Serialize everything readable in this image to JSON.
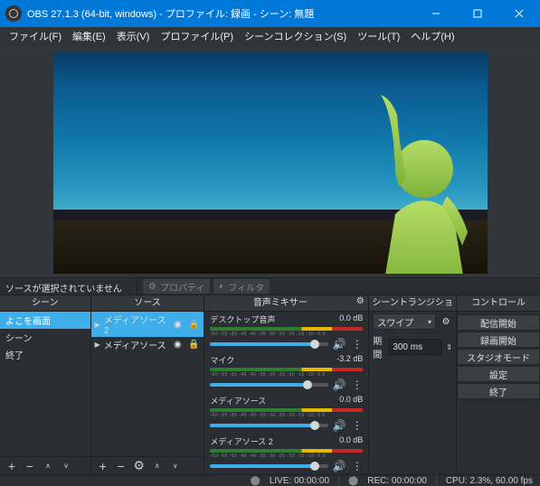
{
  "title": "OBS 27.1.3 (64-bit, windows) - プロファイル: 録画 - シーン: 無題",
  "menu": [
    "ファイル(F)",
    "編集(E)",
    "表示(V)",
    "プロファイル(P)",
    "シーンコレクション(S)",
    "ツール(T)",
    "ヘルプ(H)"
  ],
  "sources_status": "ソースが選択されていません",
  "toolbar": {
    "properties": "プロパティ",
    "filters": "フィルタ"
  },
  "docks": {
    "scenes": "シーン",
    "sources": "ソース",
    "mixer": "音声ミキサー",
    "transitions": "シーントランジション",
    "controls": "コントロール"
  },
  "scenes": [
    {
      "label": "よこを画面",
      "selected": true
    },
    {
      "label": "シーン"
    },
    {
      "label": "終了"
    }
  ],
  "source_items": [
    {
      "label": "メディアソース 2",
      "selected": true
    },
    {
      "label": "メディアソース"
    }
  ],
  "mixer": [
    {
      "name": "デスクトップ音声",
      "db": "0.0 dB",
      "pos": 88
    },
    {
      "name": "マイク",
      "db": "-3.2 dB",
      "pos": 82
    },
    {
      "name": "メディアソース",
      "db": "0.0 dB",
      "pos": 88
    },
    {
      "name": "メディアソース 2",
      "db": "0.0 dB",
      "pos": 88
    }
  ],
  "transitions": {
    "selected": "スワイプ",
    "duration_label": "期間",
    "duration_value": "300 ms"
  },
  "controls": [
    "配信開始",
    "録画開始",
    "スタジオモード",
    "設定",
    "終了"
  ],
  "status": {
    "live": "LIVE: 00:00:00",
    "rec": "REC: 00:00:00",
    "cpu": "CPU: 2.3%, 60.00 fps"
  }
}
